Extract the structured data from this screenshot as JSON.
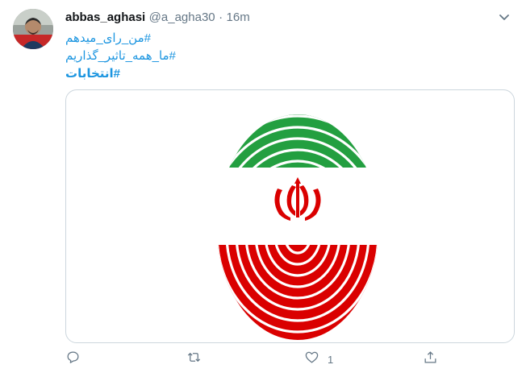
{
  "tweet": {
    "display_name": "abbas_aghasi",
    "handle": "@a_agha30",
    "separator": "·",
    "time": "16m",
    "hashtags": [
      "#من_رای_میدهم",
      "#ما_همه_تاثیر_گذاریم",
      "#انتخابات"
    ]
  },
  "media": {
    "description_icon": "fingerprint-iran-flag"
  },
  "actions": {
    "reply_icon": "reply-icon",
    "retweet_icon": "retweet-icon",
    "like_icon": "heart-icon",
    "like_count": "1",
    "share_icon": "share-icon"
  },
  "colors": {
    "accent": "#1b95e0",
    "muted": "#657786",
    "flag_green": "#239f40",
    "flag_red": "#da0000"
  }
}
